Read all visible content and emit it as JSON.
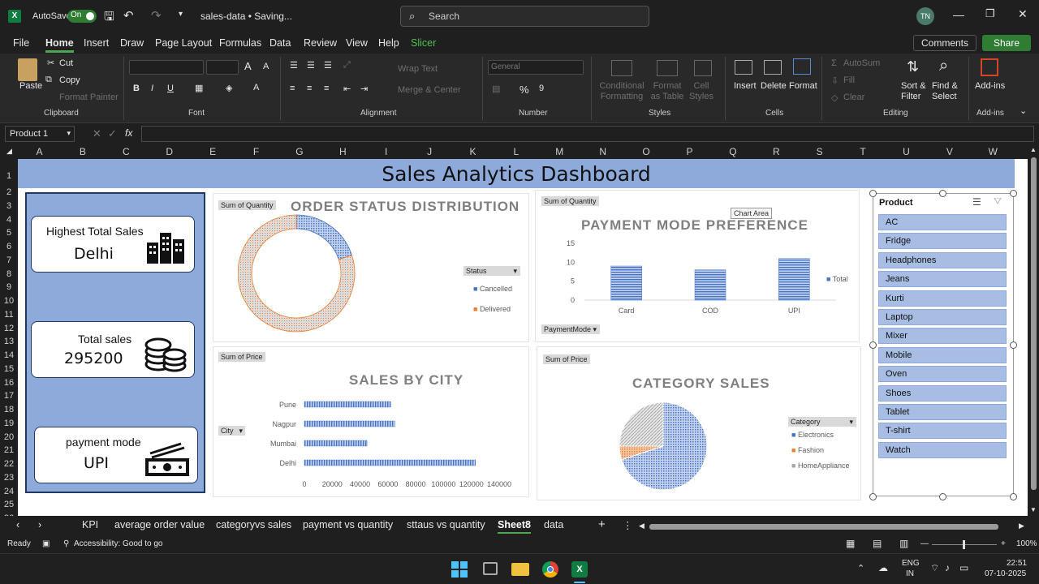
{
  "titlebar": {
    "autosave_label": "AutoSave",
    "autosave_state": "On",
    "file_title": "sales-data • Saving...",
    "search_placeholder": "Search",
    "user_initials": "TN"
  },
  "menu": {
    "items": [
      "File",
      "Home",
      "Insert",
      "Draw",
      "Page Layout",
      "Formulas",
      "Data",
      "Review",
      "View",
      "Help",
      "Slicer"
    ],
    "active": "Home",
    "comments": "Comments",
    "share": "Share"
  },
  "ribbon": {
    "clipboard": {
      "paste": "Paste",
      "cut": "Cut",
      "copy": "Copy",
      "format_painter": "Format Painter",
      "group": "Clipboard"
    },
    "font": {
      "group": "Font",
      "bold": "B",
      "italic": "I",
      "underline": "U"
    },
    "alignment": {
      "wrap": "Wrap Text",
      "merge": "Merge & Center",
      "group": "Alignment"
    },
    "number": {
      "format": "General",
      "group": "Number"
    },
    "styles": {
      "conditional": "Conditional Formatting",
      "format_table": "Format as Table",
      "cell_styles": "Cell Styles",
      "group": "Styles"
    },
    "cells": {
      "insert": "Insert",
      "delete": "Delete",
      "format": "Format",
      "group": "Cells"
    },
    "editing": {
      "autosum": "AutoSum",
      "fill": "Fill",
      "clear": "Clear",
      "sort": "Sort & Filter",
      "find": "Find & Select",
      "group": "Editing"
    },
    "addins": {
      "addins": "Add-ins",
      "group": "Add-ins"
    }
  },
  "formula_bar": {
    "name_box": "Product 1",
    "fx": "fx",
    "value": ""
  },
  "columns": [
    "A",
    "B",
    "C",
    "D",
    "E",
    "F",
    "G",
    "H",
    "I",
    "J",
    "K",
    "L",
    "M",
    "N",
    "O",
    "P",
    "Q",
    "R",
    "S",
    "T",
    "U",
    "V",
    "W"
  ],
  "rows": [
    "1",
    "2",
    "3",
    "4",
    "5",
    "6",
    "7",
    "8",
    "9",
    "10",
    "11",
    "12",
    "13",
    "14",
    "15",
    "16",
    "17",
    "18",
    "19",
    "20",
    "21",
    "22",
    "23",
    "24",
    "25",
    "26"
  ],
  "dashboard": {
    "title": "Sales Analytics Dashboard",
    "kpis": [
      {
        "label": "Highest Total Sales",
        "value": "Delhi",
        "icon": "city-buildings-icon"
      },
      {
        "label": "Total sales",
        "value": "295200",
        "icon": "coin-stack-icon"
      },
      {
        "label": "payment mode",
        "value": "UPI",
        "icon": "cash-money-icon"
      }
    ]
  },
  "charts": {
    "order_status": {
      "field_button": "Sum of Quantity",
      "title": "ORDER STATUS DISTRIBUTION",
      "legend_title": "Status",
      "legend": [
        "Cancelled",
        "Delivered"
      ],
      "colors": [
        "#4472c4",
        "#ed7d31"
      ]
    },
    "payment_mode": {
      "field_button": "Sum of Quantity",
      "tooltip": "Chart Area",
      "title": "PAYMENT MODE PREFERENCE",
      "axis_filter": "PaymentMode",
      "legend": [
        "Total"
      ]
    },
    "sales_by_city": {
      "field_button": "Sum of Price",
      "title": "SALES BY CITY",
      "axis_filter": "City"
    },
    "category_sales": {
      "field_button": "Sum of Price",
      "title": "CATEGORY SALES",
      "legend_title": "Category",
      "legend": [
        "Electronics",
        "Fashion",
        "HomeAppliance"
      ],
      "colors": [
        "#4472c4",
        "#ed7d31",
        "#a5a5a5"
      ]
    }
  },
  "chart_data": [
    {
      "type": "pie",
      "title": "ORDER STATUS DISTRIBUTION",
      "categories": [
        "Cancelled",
        "Delivered"
      ],
      "values": [
        20,
        80
      ]
    },
    {
      "type": "bar",
      "title": "PAYMENT MODE PREFERENCE",
      "categories": [
        "Card",
        "COD",
        "UPI"
      ],
      "series": [
        {
          "name": "Total",
          "values": [
            9,
            8,
            11
          ]
        }
      ],
      "ylim": [
        0,
        15
      ],
      "yticks": [
        0,
        5,
        10,
        15
      ]
    },
    {
      "type": "bar",
      "title": "SALES BY CITY",
      "orientation": "horizontal",
      "categories": [
        "Pune",
        "Nagpur",
        "Mumbai",
        "Delhi"
      ],
      "values": [
        62000,
        65000,
        45000,
        123000
      ],
      "xlim": [
        0,
        140000
      ],
      "xticks": [
        0,
        20000,
        40000,
        60000,
        80000,
        100000,
        120000,
        140000
      ]
    },
    {
      "type": "pie",
      "title": "CATEGORY SALES",
      "categories": [
        "Electronics",
        "Fashion",
        "HomeAppliance"
      ],
      "values": [
        70,
        5,
        25
      ]
    }
  ],
  "slicer": {
    "title": "Product",
    "items": [
      "AC",
      "Fridge",
      "Headphones",
      "Jeans",
      "Kurti",
      "Laptop",
      "Mixer",
      "Mobile",
      "Oven",
      "Shoes",
      "Tablet",
      "T-shirt",
      "Watch"
    ]
  },
  "sheet_tabs": {
    "tabs": [
      "KPI",
      "average order value",
      "categoryvs sales",
      "payment vs quantity",
      "sttaus vs quantity",
      "Sheet8",
      "data"
    ],
    "active": "Sheet8"
  },
  "statusbar": {
    "ready": "Ready",
    "accessibility": "Accessibility: Good to go",
    "zoom": "100%"
  },
  "taskbar": {
    "lang1": "ENG",
    "lang2": "IN",
    "time": "22:51",
    "date": "07-10-2025"
  }
}
